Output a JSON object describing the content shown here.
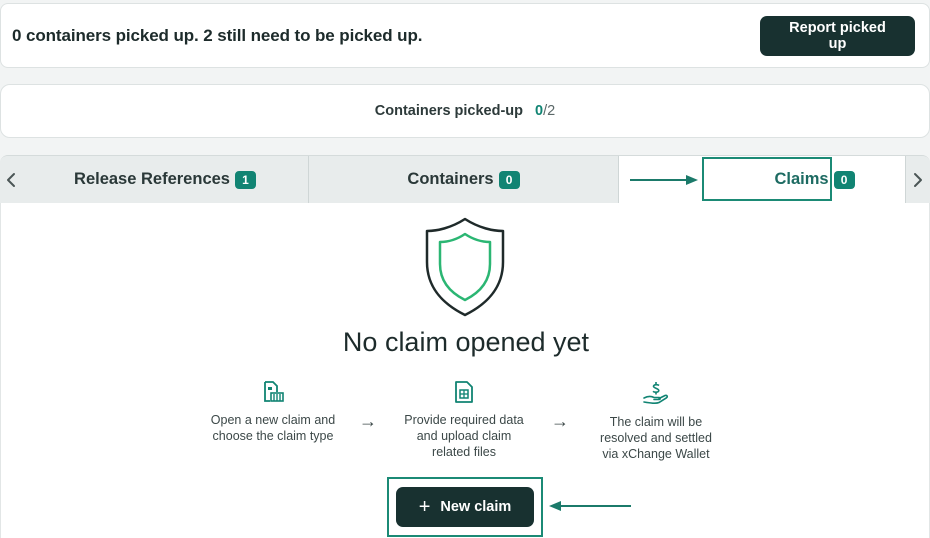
{
  "summary": {
    "status_text": "0 containers picked up. 2 still need to be picked up.",
    "report_button": "Report picked up"
  },
  "pickup": {
    "label": "Containers picked-up",
    "picked": "0",
    "total": "/2"
  },
  "tabs": [
    {
      "label": "Release References",
      "badge": "1"
    },
    {
      "label": "Containers",
      "badge": "0"
    },
    {
      "label": "Claims",
      "badge": "0",
      "active": true
    }
  ],
  "icons": {
    "prev": "chevron-left-icon",
    "next": "chevron-right-icon",
    "shield": "shield-icon",
    "step1": "claim-document-icon",
    "step2": "file-upload-icon",
    "step3": "wallet-settle-icon"
  },
  "empty_state": {
    "title": "No claim opened yet",
    "steps": [
      "Open a new claim and choose the claim type",
      "Provide required data and upload claim related files",
      "The claim will be resolved and settled via xChange Wallet"
    ],
    "new_claim_button": "New claim",
    "plus": "+",
    "step_arrow": "→"
  },
  "colors": {
    "accent": "#118473",
    "dark_button": "#183130",
    "highlight": "#1b8a75",
    "shield_green": "#2bb673"
  }
}
